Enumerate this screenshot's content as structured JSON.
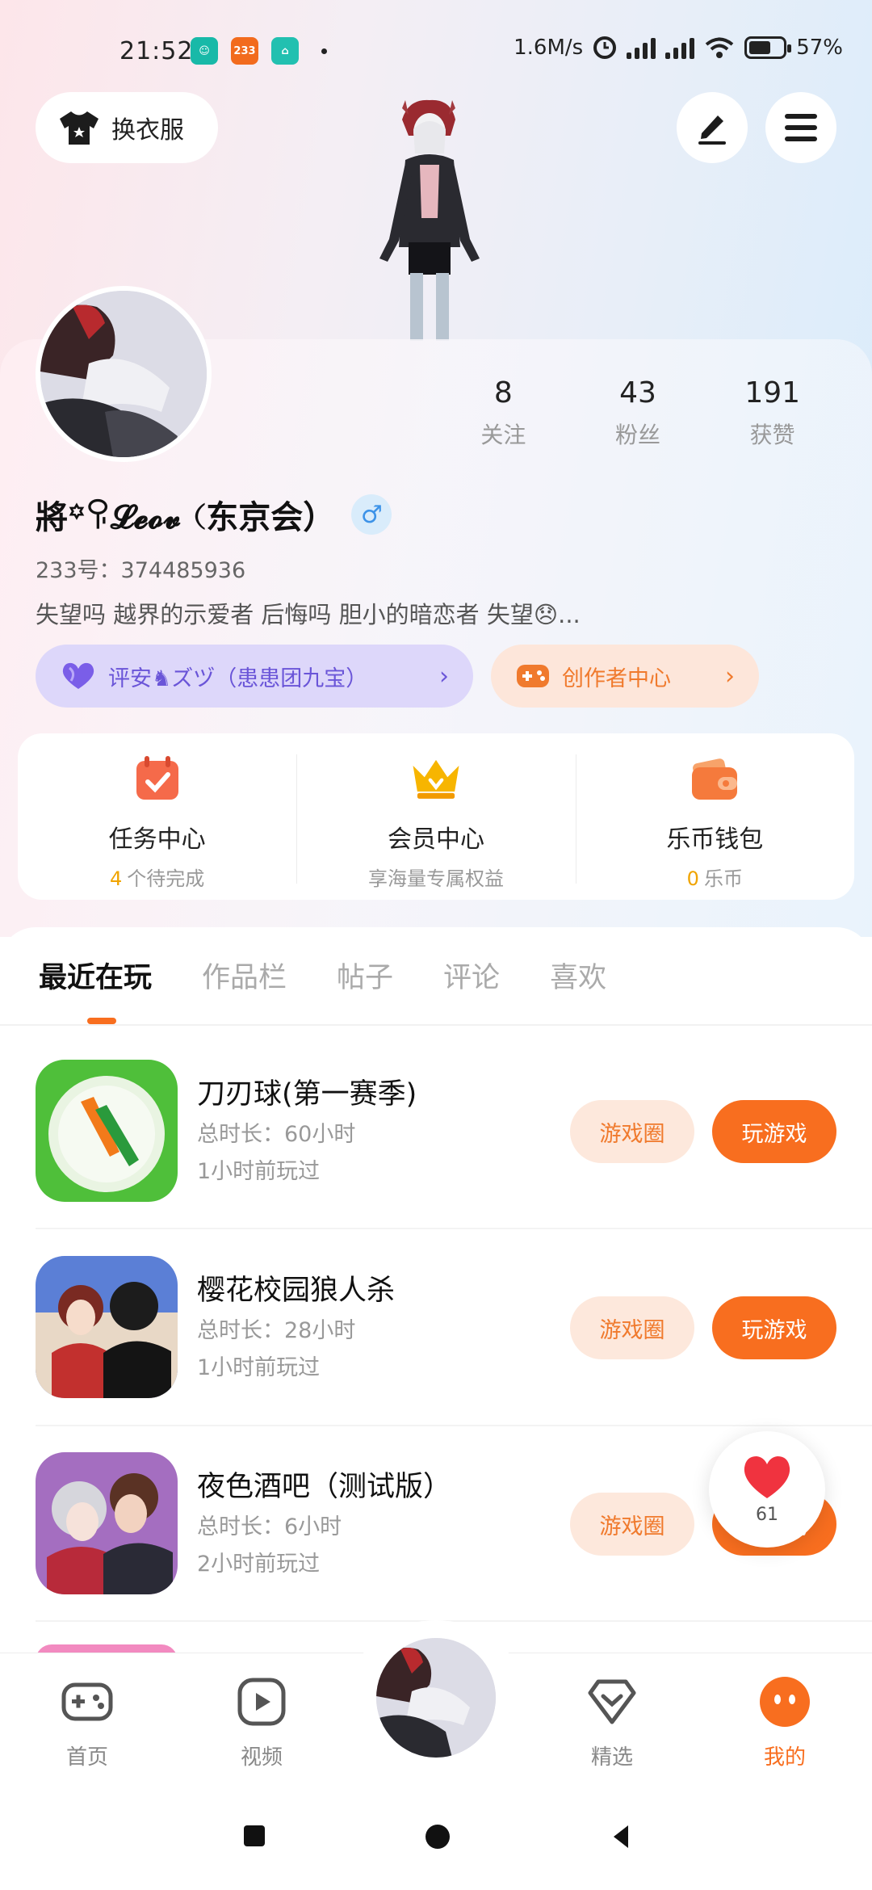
{
  "status_bar": {
    "time": "21:52",
    "app_badges": [
      "233"
    ],
    "net_speed": "1.6M/s",
    "battery": "57%"
  },
  "header": {
    "dress_up_label": "换衣服",
    "edit_icon": "pencil-icon",
    "menu_icon": "hamburger-icon"
  },
  "profile": {
    "stats": [
      {
        "value": "8",
        "label": "关注"
      },
      {
        "value": "43",
        "label": "粉丝"
      },
      {
        "value": "191",
        "label": "获赞"
      }
    ],
    "nickname": "將꙳ꀬ𝓛𝓮𝓸𝓿（东京会）",
    "gender_symbol": "♂",
    "uid": "233号：374485936",
    "bio": "失望吗 越界的示爱者 后悔吗 胆小的暗恋者 失望😞...",
    "club_label": "评安♞ズヅ（患患团九宝）",
    "club_chevron": "›",
    "creator_label": "创作者中心",
    "creator_chevron": "›"
  },
  "shortcuts": [
    {
      "title": "任务中心",
      "sub_highlight": "4",
      "sub_text": "个待完成",
      "icon": "calendar-check-icon"
    },
    {
      "title": "会员中心",
      "sub_highlight": "",
      "sub_text": "享海量专属权益",
      "icon": "crown-icon"
    },
    {
      "title": "乐币钱包",
      "sub_highlight": "0",
      "sub_text": "乐币",
      "icon": "wallet-icon"
    }
  ],
  "tabs": [
    "最近在玩",
    "作品栏",
    "帖子",
    "评论",
    "喜欢"
  ],
  "games": [
    {
      "name": "刀刃球(第一赛季)",
      "duration": "总时长：60小时",
      "last_played": "1小时前玩过",
      "circle_label": "游戏圈",
      "play_label": "玩游戏"
    },
    {
      "name": "樱花校园狼人杀",
      "duration": "总时长：28小时",
      "last_played": "1小时前玩过",
      "circle_label": "游戏圈",
      "play_label": "玩游戏"
    },
    {
      "name": "夜色酒吧（测试版）",
      "duration": "总时长：6小时",
      "last_played": "2小时前玩过",
      "circle_label": "游戏圈",
      "play_label": "玩游戏"
    }
  ],
  "like_bubble": {
    "count": "61"
  },
  "bottom_nav": [
    {
      "label": "首页",
      "icon": "gamepad-icon"
    },
    {
      "label": "视频",
      "icon": "video-play-icon"
    },
    {
      "label": "精选",
      "icon": "heart-shield-icon"
    },
    {
      "label": "我的",
      "icon": "smile-face-icon"
    }
  ],
  "colors": {
    "accent": "#f86e1f",
    "club_bg": "#ddd7fa",
    "club_text": "#6a55d8",
    "soft_orange": "#fde8dc",
    "gender_blue": "#3d93e8"
  }
}
